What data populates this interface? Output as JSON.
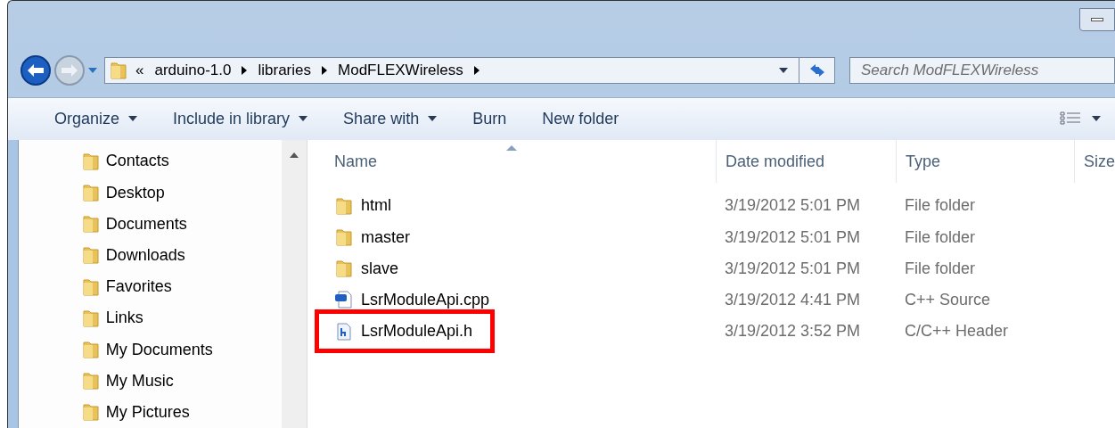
{
  "address_bar": {
    "overflow": "«",
    "crumbs": [
      "arduino-1.0",
      "libraries",
      "ModFLEXWireless"
    ]
  },
  "search": {
    "placeholder": "Search ModFLEXWireless"
  },
  "toolbar": {
    "items": [
      {
        "label": "Organize",
        "dropdown": true
      },
      {
        "label": "Include in library",
        "dropdown": true
      },
      {
        "label": "Share with",
        "dropdown": true
      },
      {
        "label": "Burn",
        "dropdown": false
      },
      {
        "label": "New folder",
        "dropdown": false
      }
    ]
  },
  "nav_pane": {
    "items": [
      "Contacts",
      "Desktop",
      "Documents",
      "Downloads",
      "Favorites",
      "Links",
      "My Documents",
      "My Music",
      "My Pictures"
    ]
  },
  "file_list": {
    "columns": [
      {
        "label": "Name",
        "sorted": true
      },
      {
        "label": "Date modified",
        "sorted": false
      },
      {
        "label": "Type",
        "sorted": false
      },
      {
        "label": "Size",
        "sorted": false
      }
    ],
    "rows": [
      {
        "kind": "folder",
        "name": "html",
        "date": "3/19/2012 5:01 PM",
        "type": "File folder",
        "highlighted": false
      },
      {
        "kind": "folder",
        "name": "master",
        "date": "3/19/2012 5:01 PM",
        "type": "File folder",
        "highlighted": false
      },
      {
        "kind": "folder",
        "name": "slave",
        "date": "3/19/2012 5:01 PM",
        "type": "File folder",
        "highlighted": false
      },
      {
        "kind": "cpp",
        "name": "LsrModuleApi.cpp",
        "date": "3/19/2012 4:41 PM",
        "type": "C++ Source",
        "highlighted": false
      },
      {
        "kind": "h",
        "name": "LsrModuleApi.h",
        "date": "3/19/2012 3:52 PM",
        "type": "C/C++ Header",
        "highlighted": true
      }
    ]
  }
}
